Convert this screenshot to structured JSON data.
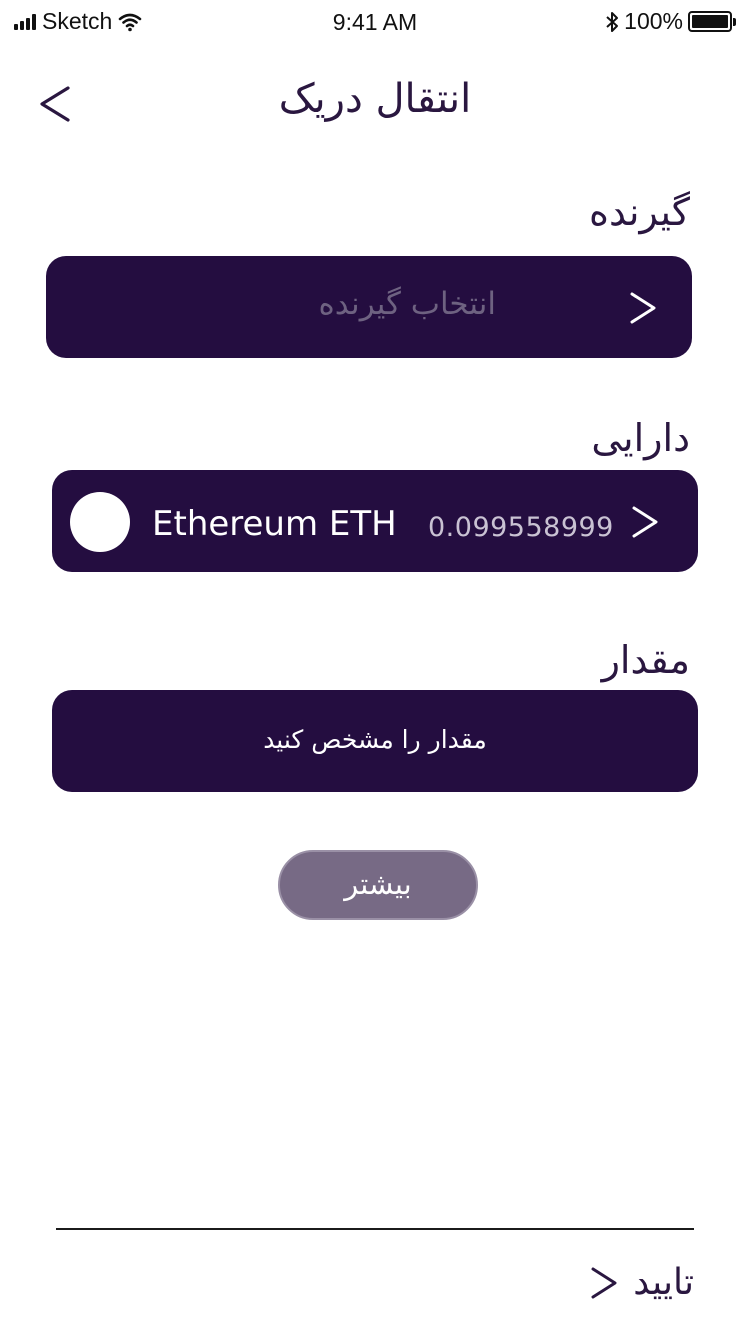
{
  "status_bar": {
    "carrier": "Sketch",
    "time": "9:41 AM",
    "battery": "100%",
    "battery_level": 1.0
  },
  "header": {
    "title": "انتقال دریک",
    "back_icon": "chevron-left-icon"
  },
  "recipient": {
    "label": "گیرنده",
    "placeholder": "انتخاب گیرنده",
    "chevron_icon": "chevron-right-icon"
  },
  "asset": {
    "label": "دارایی",
    "name": "Ethereum ETH",
    "balance": "0.099558999",
    "chevron_icon": "chevron-right-icon"
  },
  "amount": {
    "label": "مقدار",
    "placeholder": "مقدار را مشخص کنید"
  },
  "more_button": {
    "label": "بیشتر"
  },
  "footer": {
    "confirm_label": "تایید",
    "chevron_icon": "chevron-right-icon"
  },
  "colors": {
    "row_background": "#240d40",
    "title_text": "#2a1740",
    "more_button_background": "#776a85",
    "placeholder_text": "#6e6281"
  }
}
